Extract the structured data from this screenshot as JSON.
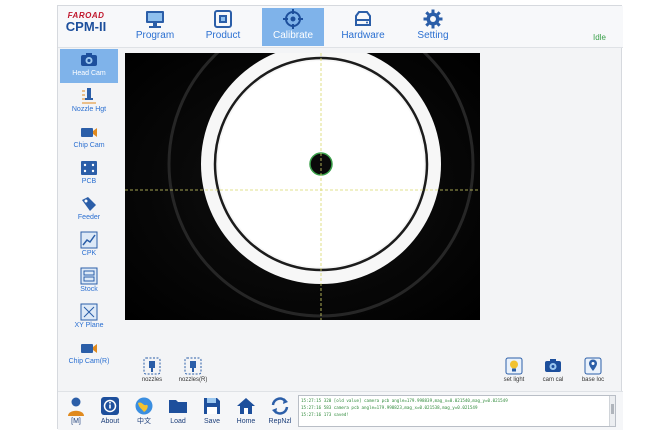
{
  "brand": {
    "top": "FAROAD",
    "name": "CPM-II"
  },
  "status": "Idle",
  "colors": {
    "accent": "#2a6fd1",
    "active_bg": "#7fb3ea",
    "status_ok": "#3aa04a",
    "brand_red": "#c0172c"
  },
  "tabs": [
    {
      "label": "Program",
      "icon": "monitor-icon"
    },
    {
      "label": "Product",
      "icon": "chip-board-icon"
    },
    {
      "label": "Calibrate",
      "icon": "crosshair-icon",
      "active": true
    },
    {
      "label": "Hardware",
      "icon": "drive-icon"
    },
    {
      "label": "Setting",
      "icon": "gear-icon"
    }
  ],
  "sidebar": {
    "items": [
      {
        "label": "Head Cam",
        "icon": "camera-icon",
        "active": true
      },
      {
        "label": "Nozzle Hgt",
        "icon": "nozzle-height-icon"
      },
      {
        "label": "Chip Cam",
        "icon": "video-camera-icon"
      },
      {
        "label": "PCB",
        "icon": "pcb-icon"
      },
      {
        "label": "Feeder",
        "icon": "feeder-icon"
      },
      {
        "label": "CPK",
        "icon": "cpk-icon"
      },
      {
        "label": "Stock",
        "icon": "stock-icon"
      },
      {
        "label": "XY Plane",
        "icon": "xy-plane-icon"
      },
      {
        "label": "Chip Cam(R)",
        "icon": "video-camera-icon"
      }
    ]
  },
  "camera_tools": {
    "nozzles": "nozzles",
    "nozzles_r": "nozzles(R)",
    "set_light": "set light",
    "cam_cal": "cam cal",
    "base_loc": "base loc"
  },
  "bottom": {
    "buttons": [
      {
        "label": "[M]",
        "icon": "user-icon"
      },
      {
        "label": "About",
        "icon": "info-icon"
      },
      {
        "label": "中文",
        "icon": "language-icon"
      },
      {
        "label": "Load",
        "icon": "folder-icon"
      },
      {
        "label": "Save",
        "icon": "save-icon"
      },
      {
        "label": "Home",
        "icon": "home-icon"
      },
      {
        "label": "RepNzl",
        "icon": "replace-nozzle-icon"
      }
    ]
  },
  "log": [
    "15:27:15 320 [old value] camera pcb angle=179.998839,mag_x=0.021540,mag_y=0.021549",
    "15:27:16 583 camera pcb angle=179.998823,mag_x=0.021538,mag_y=0.021549",
    "15:27:16 173 saved!"
  ]
}
